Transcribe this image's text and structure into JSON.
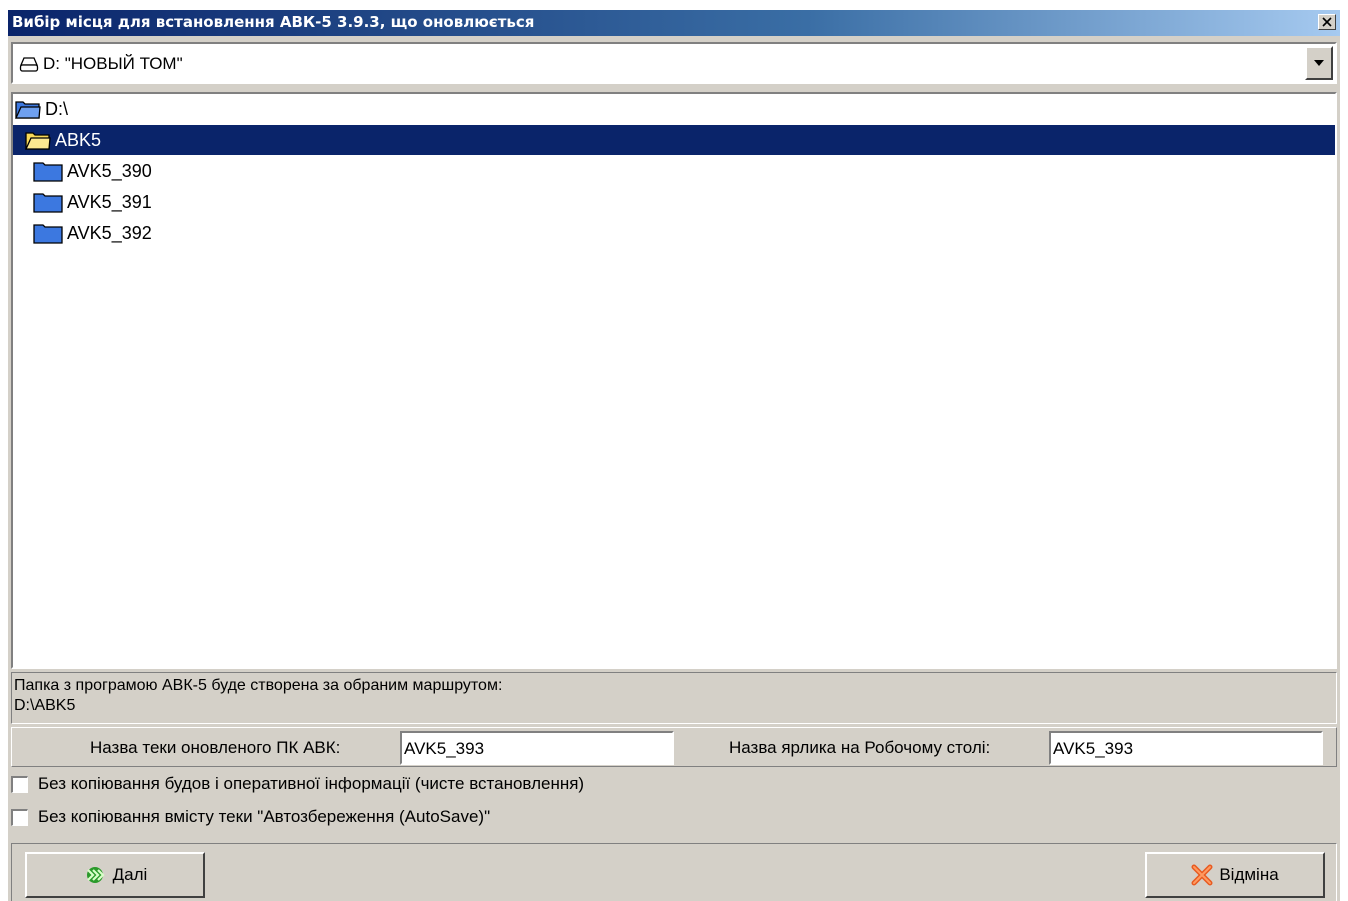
{
  "window": {
    "title": "Вибір місця для встановлення АВК-5 3.9.3, що оновлюється",
    "close_glyph": "✕"
  },
  "drive_select": {
    "value": "D: \"НОВЫЙ ТОМ\"",
    "icon": "drive-icon"
  },
  "tree": {
    "root": "D:\\",
    "selected": "ABK5",
    "children": [
      "AVK5_390",
      "AVK5_391",
      "AVK5_392"
    ]
  },
  "info": {
    "line1": "Папка з програмою АВК-5 буде створена за обраним маршрутом:",
    "line2": "D:\\ABK5"
  },
  "names": {
    "folder_label": "Назва теки оновленого ПК АВК:",
    "folder_value": "AVK5_393",
    "shortcut_label": "Назва ярлика на Робочому столі:",
    "shortcut_value": "AVK5_393"
  },
  "options": {
    "clean_install": "Без копіювання будов і оперативної інформації (чисте встановлення)",
    "no_autosave": "Без копіювання вмісту теки \"Автозбереження (AutoSave)\""
  },
  "buttons": {
    "next": "Далі",
    "cancel": "Відміна"
  },
  "colors": {
    "title_bar": "#0a246a",
    "selection": "#0a246a",
    "dialog_bg": "#d4d0c8",
    "folder_blue": "#3c78e0",
    "folder_yellow": "#f8d858"
  }
}
